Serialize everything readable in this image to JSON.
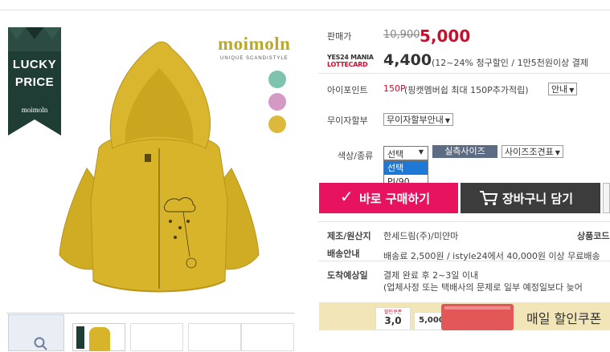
{
  "image_panel": {
    "badge": {
      "line1": "LUCKY",
      "line2": "PRICE",
      "logo": "moimoln"
    },
    "brand": {
      "logo": "moimoln",
      "tagline": "UNIQUE SCANDISTYLE"
    },
    "swatches": [
      "#7ec3ad",
      "#d49ac4",
      "#dcb93c"
    ],
    "jacket_color": "#d7b42a"
  },
  "price": {
    "label": "판매가",
    "original": "10,900",
    "sale": "5,000"
  },
  "yes24": {
    "logo_top": "YES24 MANIA",
    "logo_bottom": "LOTTECARD",
    "price": "4,400",
    "desc": "(12~24% 청구할인 / 1만5천원이상 결제"
  },
  "ipoint": {
    "label": "아이포인트",
    "points": "150P",
    "desc": "(핑캣멤버쉽 최대 150P추가적립)",
    "guide": "안내"
  },
  "installment": {
    "label": "무이자할부",
    "button": "무이자할부안내"
  },
  "option": {
    "label": "색상/종류",
    "select_value": "선택",
    "dropdown": [
      "선택",
      "PI/90"
    ],
    "size_button": "실측사이즈",
    "size_table": "사이즈조견표"
  },
  "actions": {
    "buy": "바로 구매하기",
    "cart": "장바구니 담기"
  },
  "info": {
    "origin_label": "제조/원산지",
    "origin_value": "한세드림(주)/미얀마",
    "product_code_label": "상품코드",
    "shipping_label": "배송안내",
    "shipping_value": "배송료 2,500원 / istyle24에서 40,000원 이상 무료배송",
    "arrival_label": "도착예상일",
    "arrival_value1": "결제 완료 후 2~3일 이내",
    "arrival_value2": "(업체사정 또는 택배사의 문제로 일부 예정일보다 늦어"
  },
  "banner": {
    "text": "매일 할인쿠폰",
    "coupon_label": "할인쿠폰",
    "coupon_value": "3,0",
    "coupon_value2": "5,000"
  }
}
